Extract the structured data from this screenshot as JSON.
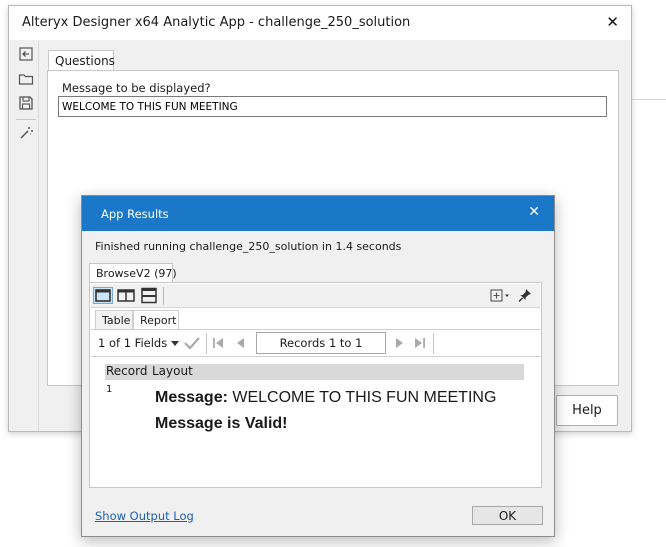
{
  "app_window": {
    "title": "Alteryx Designer x64 Analytic App - challenge_250_solution",
    "tab_questions": "Questions",
    "question_label": "Message to be displayed?",
    "question_value": "WELCOME TO THIS FUN MEETING",
    "help_label": "Help",
    "toolbar_icons": [
      "back-arrow-icon",
      "folder-icon",
      "save-icon",
      "magic-wand-icon"
    ]
  },
  "results_dialog": {
    "title": "App Results",
    "status": "Finished running challenge_250_solution in 1.4 seconds",
    "browse_tab": "BrowseV2 (97)",
    "view_tabs": [
      "Table",
      "Report"
    ],
    "active_view": "Report",
    "fields_selector": "1 of 1 Fields",
    "records_label": "Records 1 to 1",
    "report_header": {
      "col1": "Record",
      "col2": "Layout"
    },
    "record_number": "1",
    "message_label": "Message:",
    "message_value": "WELCOME TO THIS FUN MEETING",
    "valid_text": "Message is Valid!",
    "show_log_label": "Show Output Log",
    "ok_label": "OK"
  },
  "colors": {
    "titlebar_blue": "#1b78c8",
    "link_blue": "#1a5fb4",
    "window_bg": "#f0f0f0"
  }
}
